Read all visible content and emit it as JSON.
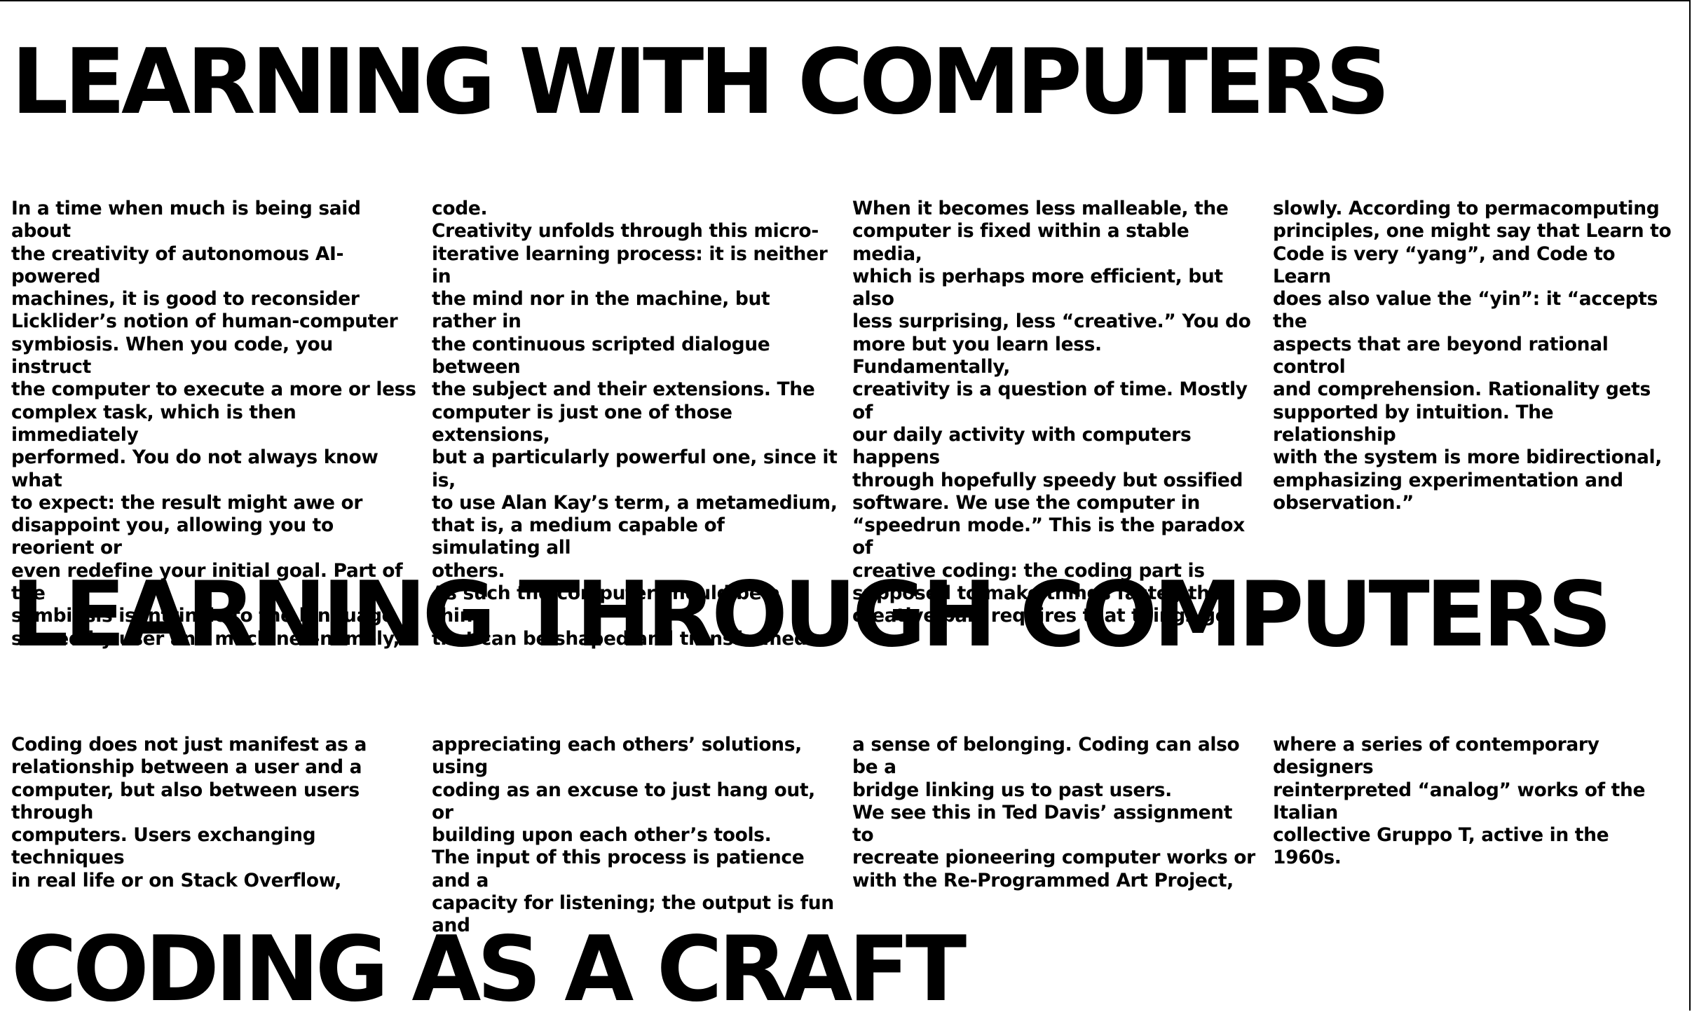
{
  "sections": [
    {
      "heading": "LEARNING WITH COMPUTERS",
      "columns": [
        "In a time when much is being said about\nthe creativity of autonomous AI-powered\nmachines, it is good to reconsider\nLicklider’s notion of human-computer\nsymbiosis. When you code, you instruct\nthe computer to execute a more or less\ncomplex task, which is then immediately\nperformed. You do not always know what\nto expect: the result might awe or\ndisappoint you, allowing you to reorient or\neven redefine your initial goal. Part of the\nsymbiosis is intrinsic to the language\nshared by user and machine—namely,",
        "code.\nCreativity unfolds through this micro-\niterative learning process: it is neither in\nthe mind nor in the machine, but rather in\nthe continuous scripted dialogue between\nthe subject and their extensions. The\ncomputer is just one of those extensions,\nbut a particularly powerful one, since it is,\nto use Alan Kay’s term, a metamedium,\nthat is, a medium capable of simulating all\nothers.\nAs such the computer should be a thing\nthat can be shaped and transformed.",
        "When it becomes less malleable, the\ncomputer is fixed within a stable media,\nwhich is perhaps more efficient, but also\nless surprising, less “creative.” You do\nmore but you learn less. Fundamentally,\ncreativity is a question of time. Mostly of\nour daily activity with computers happens\nthrough hopefully speedy but ossified\nsoftware. We use the computer in\n“speedrun mode.” This is the paradox of\ncreative coding: the coding part is\nsupposed to make things faster, the\ncreative part requires that things go",
        "slowly. According to permacomputing\nprinciples, one might say that Learn to\nCode is very “yang”, and Code to Learn\ndoes also value the “yin”: it “accepts the\naspects that are beyond rational control\nand comprehension. Rationality gets\nsupported by intuition. The relationship\nwith the system is more bidirectional,\nemphasizing experimentation and\nobservation.”"
      ]
    },
    {
      "heading": "LEARNING THROUGH COMPUTERS",
      "columns": [
        "Coding does not just manifest as a\nrelationship between a user and a\ncomputer, but also between users through\ncomputers. Users exchanging techniques\nin real life or on Stack Overflow,",
        "appreciating each others’ solutions, using\ncoding as an excuse to just hang out, or\nbuilding upon each other’s tools.\nThe input of this process is patience and a\ncapacity for listening; the output is fun and",
        "a sense of belonging. Coding can also be a\nbridge linking us to past users.\nWe see this in Ted Davis’ assignment to\nrecreate pioneering computer works or\nwith the Re-Programmed Art Project,",
        "where a series of contemporary designers\nreinterpreted “analog” works of the Italian\ncollective Gruppo T, active in the 1960s."
      ]
    },
    {
      "heading": "CODING AS A CRAFT"
    }
  ]
}
